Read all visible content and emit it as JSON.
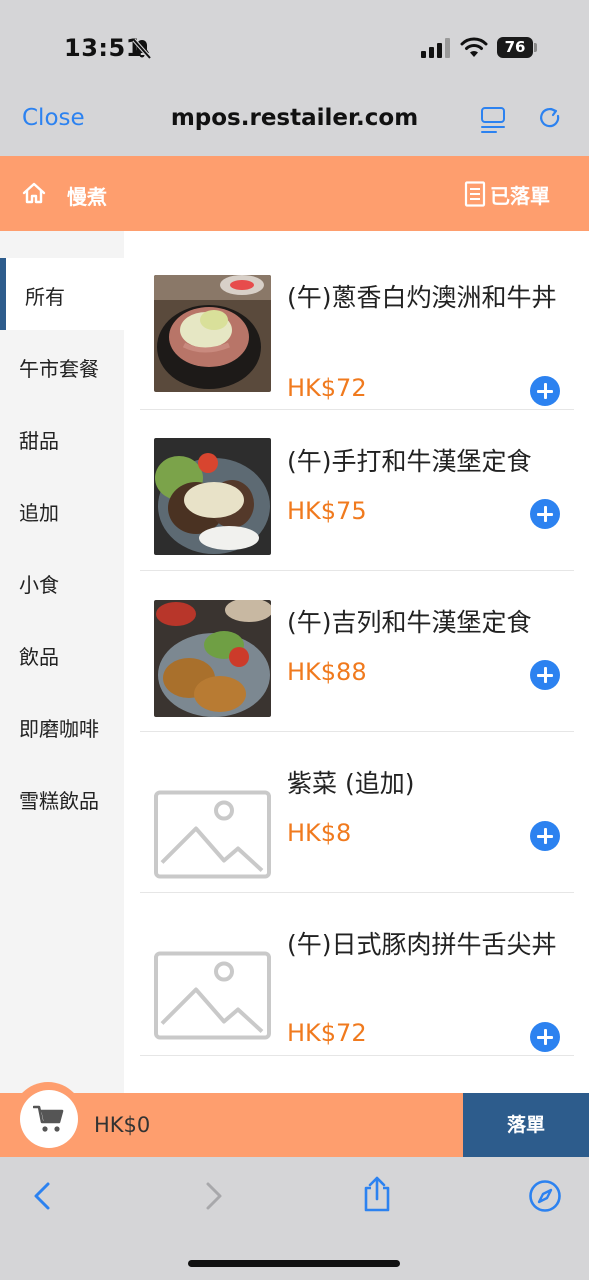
{
  "status_bar": {
    "time": "13:51",
    "battery": "76"
  },
  "browser": {
    "close_label": "Close",
    "url": "mpos.restailer.com"
  },
  "app_header": {
    "shop_name": "慢煮",
    "orders_label": "已落單"
  },
  "sidebar": {
    "items": [
      {
        "label": "所有",
        "active": true
      },
      {
        "label": "午市套餐"
      },
      {
        "label": "甜品"
      },
      {
        "label": "追加"
      },
      {
        "label": "小食"
      },
      {
        "label": "飲品"
      },
      {
        "label": "即磨咖啡"
      },
      {
        "label": "雪糕飲品"
      }
    ]
  },
  "products": [
    {
      "name": "(午)蔥香白灼澳洲和牛丼",
      "price": "HK$72",
      "image": "beef-bowl-photo"
    },
    {
      "name": "(午)手打和牛漢堡定食",
      "price": "HK$75",
      "image": "hamburg-steak-photo"
    },
    {
      "name": "(午)吉列和牛漢堡定食",
      "price": "HK$88",
      "image": "cutlet-photo"
    },
    {
      "name": "紫菜 (追加)",
      "price": "HK$8",
      "image": "placeholder-image-icon"
    },
    {
      "name": "(午)日式豚肉拼牛舌尖丼",
      "price": "HK$72",
      "image": "placeholder-image-icon"
    }
  ],
  "cart": {
    "total": "HK$0",
    "checkout_label": "落單"
  },
  "colors": {
    "accent": "#fe9e6e",
    "price": "#f07a1e",
    "primary_blue": "#2c82f0",
    "checkout": "#2d5c8c"
  }
}
